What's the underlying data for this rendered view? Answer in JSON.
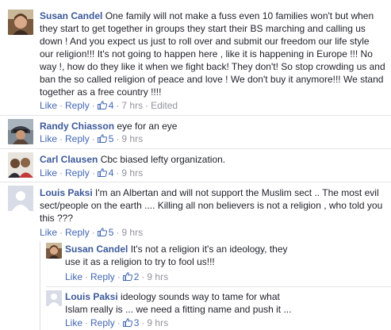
{
  "comments": [
    {
      "author": "Susan Candel",
      "text": "One family will not make a fuss even 10 families won't but when they start to get together in groups they start their BS marching and calling us down ! And you expect us just to roll over and submit our freedom our life style our religion!!! It's not going to happen here , like it is happening in Europe !!! No way !, how do they like it when we fight back! They don't! So stop crowding us and ban the so called religion of peace and love ! We don't buy it anymore!!! We stand together as a free country !!!!",
      "like": "Like",
      "reply": "Reply",
      "likes": "4",
      "time": "7 hrs",
      "edited": "Edited"
    },
    {
      "author": "Randy Chiasson",
      "text": "eye for an eye",
      "like": "Like",
      "reply": "Reply",
      "likes": "5",
      "time": "9 hrs"
    },
    {
      "author": "Carl Clausen",
      "text": "Cbc biased lefty organization.",
      "like": "Like",
      "reply": "Reply",
      "likes": "4",
      "time": "9 hrs"
    },
    {
      "author": "Louis Paksi",
      "text": "I'm an Albertan and will not support the Muslim sect .. The most evil sect/people on the earth .... Killing all non believers is not a religion , who told you this ???",
      "like": "Like",
      "reply": "Reply",
      "likes": "5",
      "time": "9 hrs"
    }
  ],
  "replies": [
    {
      "author": "Susan Candel",
      "text": "It's not a religion it's an ideology, they use it as a religion to try to fool us!!!",
      "like": "Like",
      "reply": "Reply",
      "likes": "2",
      "time": "9 hrs"
    },
    {
      "author": "Louis Paksi",
      "text": "ideology sounds way to tame for what Islam really is ... we need a fitting name and push it ...",
      "like": "Like",
      "reply": "Reply",
      "likes": "3",
      "time": "9 hrs"
    }
  ],
  "separator": "·",
  "colors": {
    "author": "#3b5998",
    "link": "#4267b2",
    "meta": "#90949c",
    "text": "#1d2129"
  }
}
